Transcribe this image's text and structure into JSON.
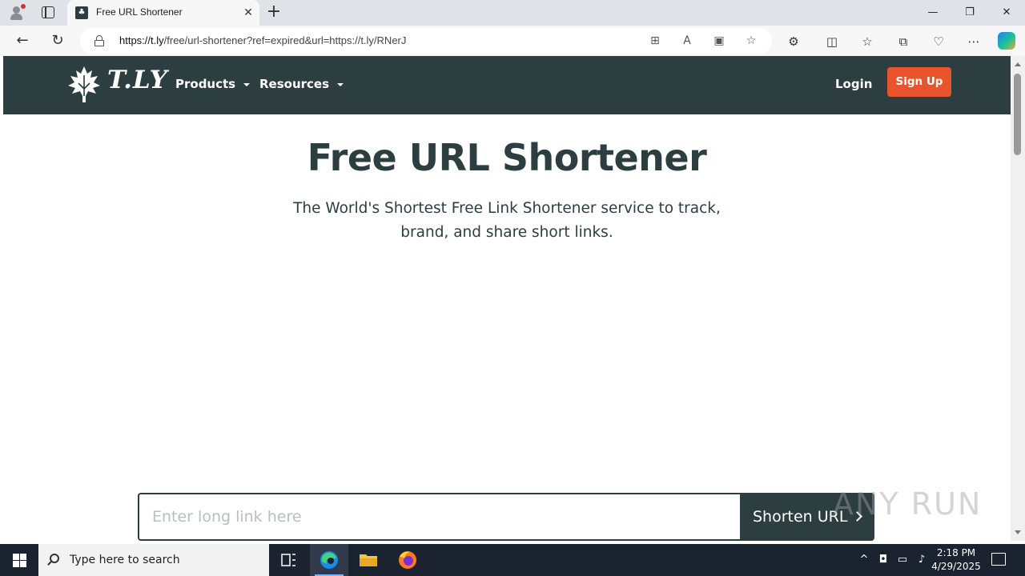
{
  "browser": {
    "tab_title": "Free URL Shortener",
    "url_host": "https://t.ly",
    "url_path": "/free/url-shortener?ref=expired&url=https://t.ly/RNerJ"
  },
  "site": {
    "logo_text": "T.LY",
    "nav": {
      "products": "Products",
      "resources": "Resources",
      "login": "Login",
      "signup": "Sign Up"
    },
    "brand_colors": {
      "header": "#2c3e40",
      "accent": "#e8542b"
    }
  },
  "hero": {
    "title": "Free URL Shortener",
    "subtitle": "The World's Shortest Free Link Shortener service to track, brand, and share short links."
  },
  "form": {
    "input_placeholder": "Enter long link here",
    "button_label": "Shorten URL"
  },
  "watermark": "ANY RUN",
  "taskbar": {
    "search_placeholder": "Type here to search",
    "time": "2:18 PM",
    "date": "4/29/2025"
  }
}
